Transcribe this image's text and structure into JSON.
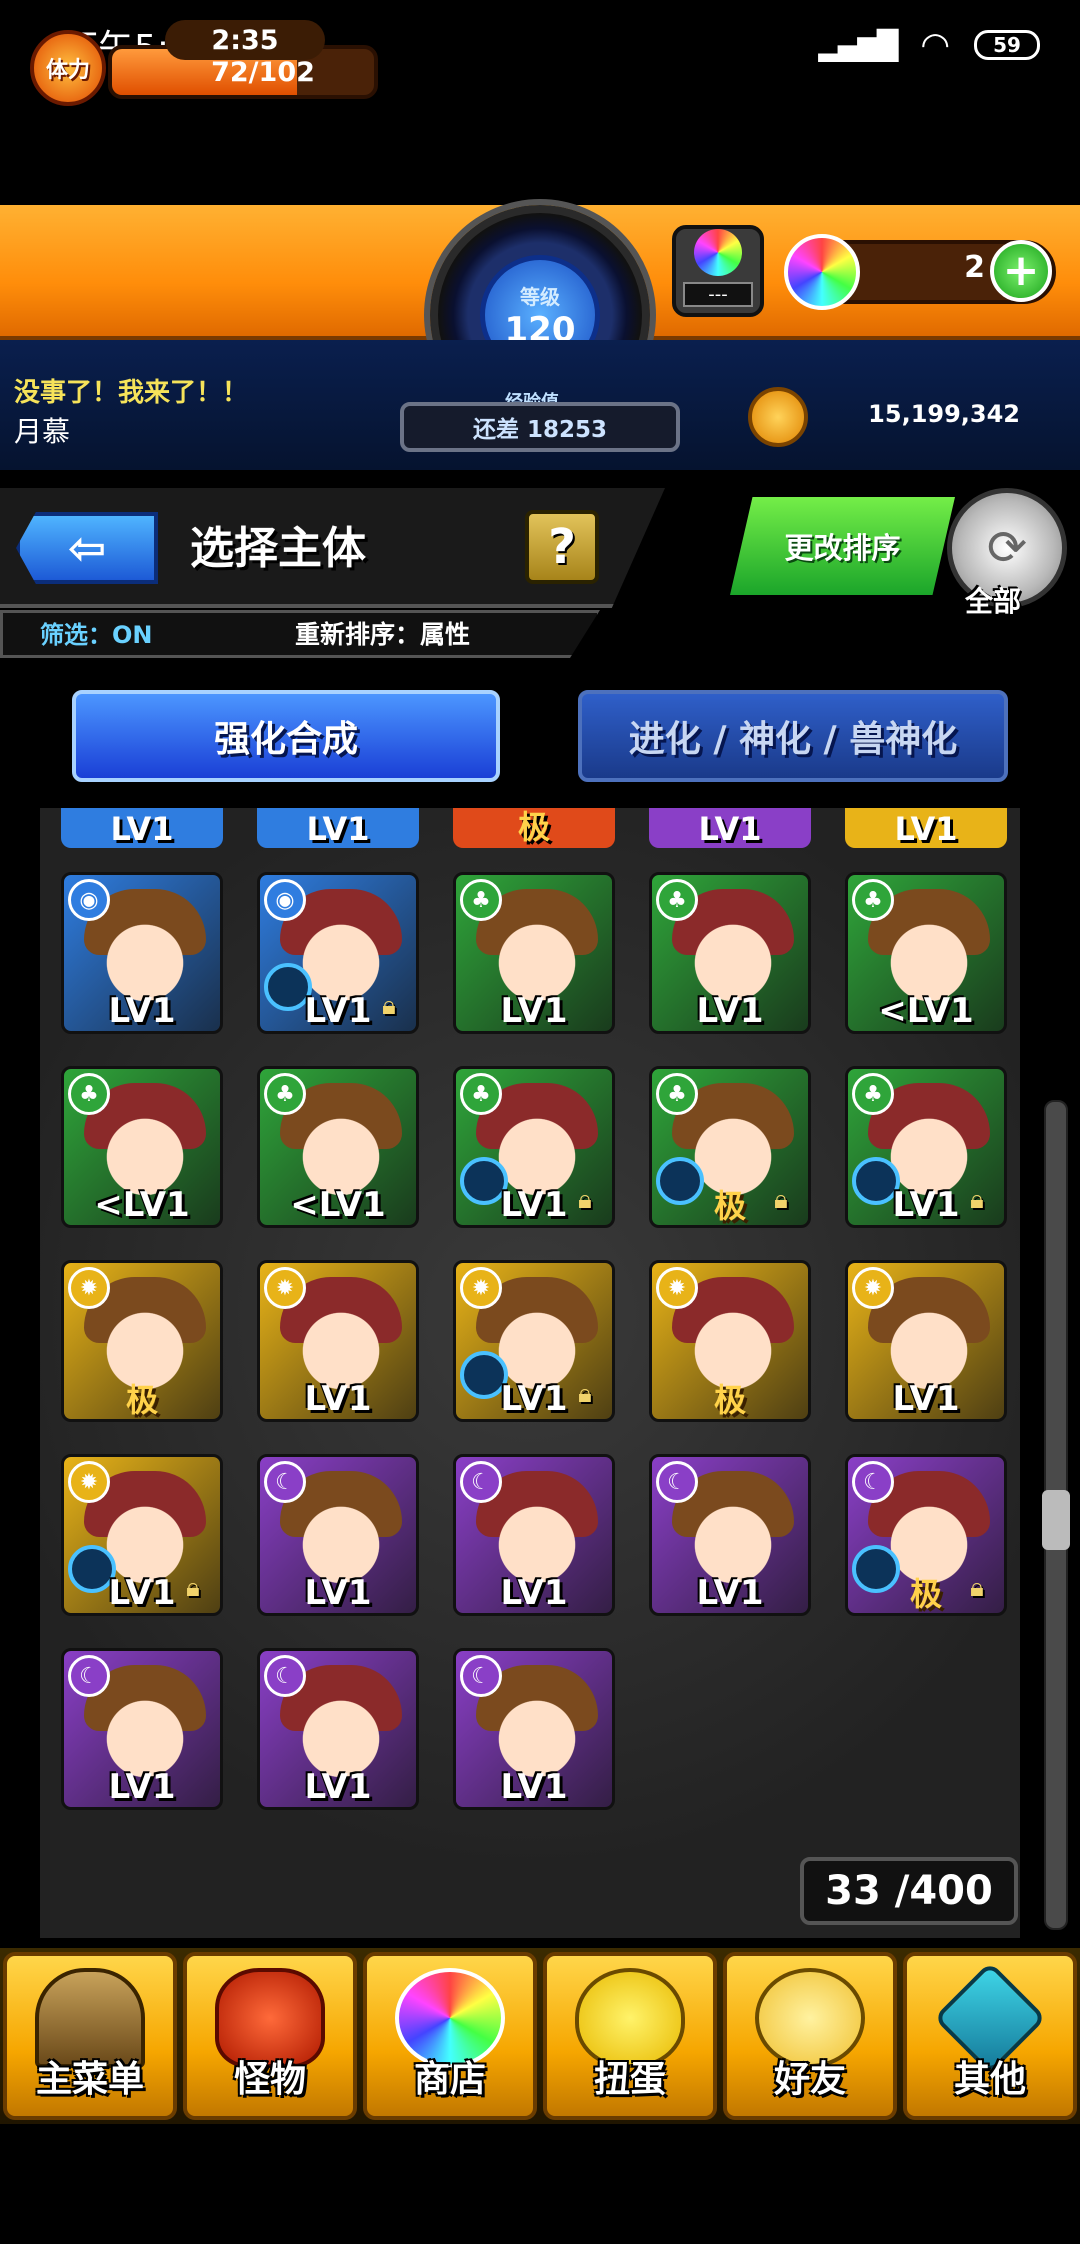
{
  "status_bar": {
    "time": "下午5:20",
    "battery": "59"
  },
  "hud": {
    "stamina_label": "体力",
    "stamina_timer": "2:35",
    "stamina_value": "72/102",
    "stamina_fraction": 0.706,
    "level_label": "等级",
    "level_value": "120",
    "exp_label": "经验值",
    "exp_remaining": "还差 18253",
    "stone_label": "---",
    "orb_count": "2",
    "plus_label": "+",
    "coin_total": "15,199,342"
  },
  "player": {
    "message": "没事了！我来了！！",
    "name": "月慕"
  },
  "header": {
    "title": "选择主体",
    "help_label": "?",
    "filter_label": "筛选：ON",
    "sort_label": "重新排序：属性",
    "sort_change_label": "更改排序",
    "refresh_label": "全部"
  },
  "tabs": [
    {
      "label": "强化合成",
      "active": true
    },
    {
      "label": "进化 / 神化 / 兽神化",
      "active": false
    }
  ],
  "partial_row": [
    "LV1",
    "LV1",
    "极",
    "LV1",
    "LV1"
  ],
  "monsters": [
    {
      "attr": "water",
      "lv": "LV1",
      "lock": false,
      "orb": false,
      "max": false
    },
    {
      "attr": "water",
      "lv": "LV1",
      "lock": true,
      "orb": true,
      "max": false
    },
    {
      "attr": "wood",
      "lv": "LV1",
      "lock": false,
      "orb": false,
      "max": false
    },
    {
      "attr": "wood",
      "lv": "LV1",
      "lock": false,
      "orb": false,
      "max": false
    },
    {
      "attr": "wood",
      "lv": "<LV1",
      "lock": false,
      "orb": false,
      "max": false
    },
    {
      "attr": "wood",
      "lv": "<LV1",
      "lock": false,
      "orb": false,
      "max": false
    },
    {
      "attr": "wood",
      "lv": "<LV1",
      "lock": false,
      "orb": false,
      "max": false
    },
    {
      "attr": "wood",
      "lv": "LV1",
      "lock": true,
      "orb": true,
      "max": false
    },
    {
      "attr": "wood",
      "lv": "",
      "lock": true,
      "orb": true,
      "max": true
    },
    {
      "attr": "wood",
      "lv": "LV1",
      "lock": true,
      "orb": true,
      "max": false
    },
    {
      "attr": "light",
      "lv": "",
      "lock": false,
      "orb": false,
      "max": true
    },
    {
      "attr": "light",
      "lv": "LV1",
      "lock": false,
      "orb": false,
      "max": false
    },
    {
      "attr": "light",
      "lv": "LV1",
      "lock": true,
      "orb": true,
      "max": false
    },
    {
      "attr": "light",
      "lv": "",
      "lock": false,
      "orb": false,
      "max": true
    },
    {
      "attr": "light",
      "lv": "LV1",
      "lock": false,
      "orb": false,
      "max": false
    },
    {
      "attr": "light",
      "lv": "LV1",
      "lock": true,
      "orb": true,
      "max": false
    },
    {
      "attr": "dark",
      "lv": "LV1",
      "lock": false,
      "orb": false,
      "max": false
    },
    {
      "attr": "dark",
      "lv": "LV1",
      "lock": false,
      "orb": false,
      "max": false
    },
    {
      "attr": "dark",
      "lv": "LV1",
      "lock": false,
      "orb": false,
      "max": false
    },
    {
      "attr": "dark",
      "lv": "",
      "lock": true,
      "orb": true,
      "max": true
    },
    {
      "attr": "dark",
      "lv": "LV1",
      "lock": false,
      "orb": false,
      "max": false
    },
    {
      "attr": "dark",
      "lv": "LV1",
      "lock": false,
      "orb": false,
      "max": false
    },
    {
      "attr": "dark",
      "lv": "LV1",
      "lock": false,
      "orb": false,
      "max": false
    }
  ],
  "max_label": "极",
  "box_count": "33 /400",
  "attr_colors": {
    "water": "#2f7de0",
    "wood": "#2fa53a",
    "light": "#e8b318",
    "dark": "#8a3fc7",
    "fire": "#e04a1a"
  },
  "bottom_nav": [
    {
      "label": "主菜单",
      "icon": "gate-icon"
    },
    {
      "label": "怪物",
      "icon": "monster-icon"
    },
    {
      "label": "商店",
      "icon": "rainbow-orb-icon"
    },
    {
      "label": "扭蛋",
      "icon": "egg-icon"
    },
    {
      "label": "好友",
      "icon": "friends-icon"
    },
    {
      "label": "其他",
      "icon": "other-icon"
    }
  ]
}
